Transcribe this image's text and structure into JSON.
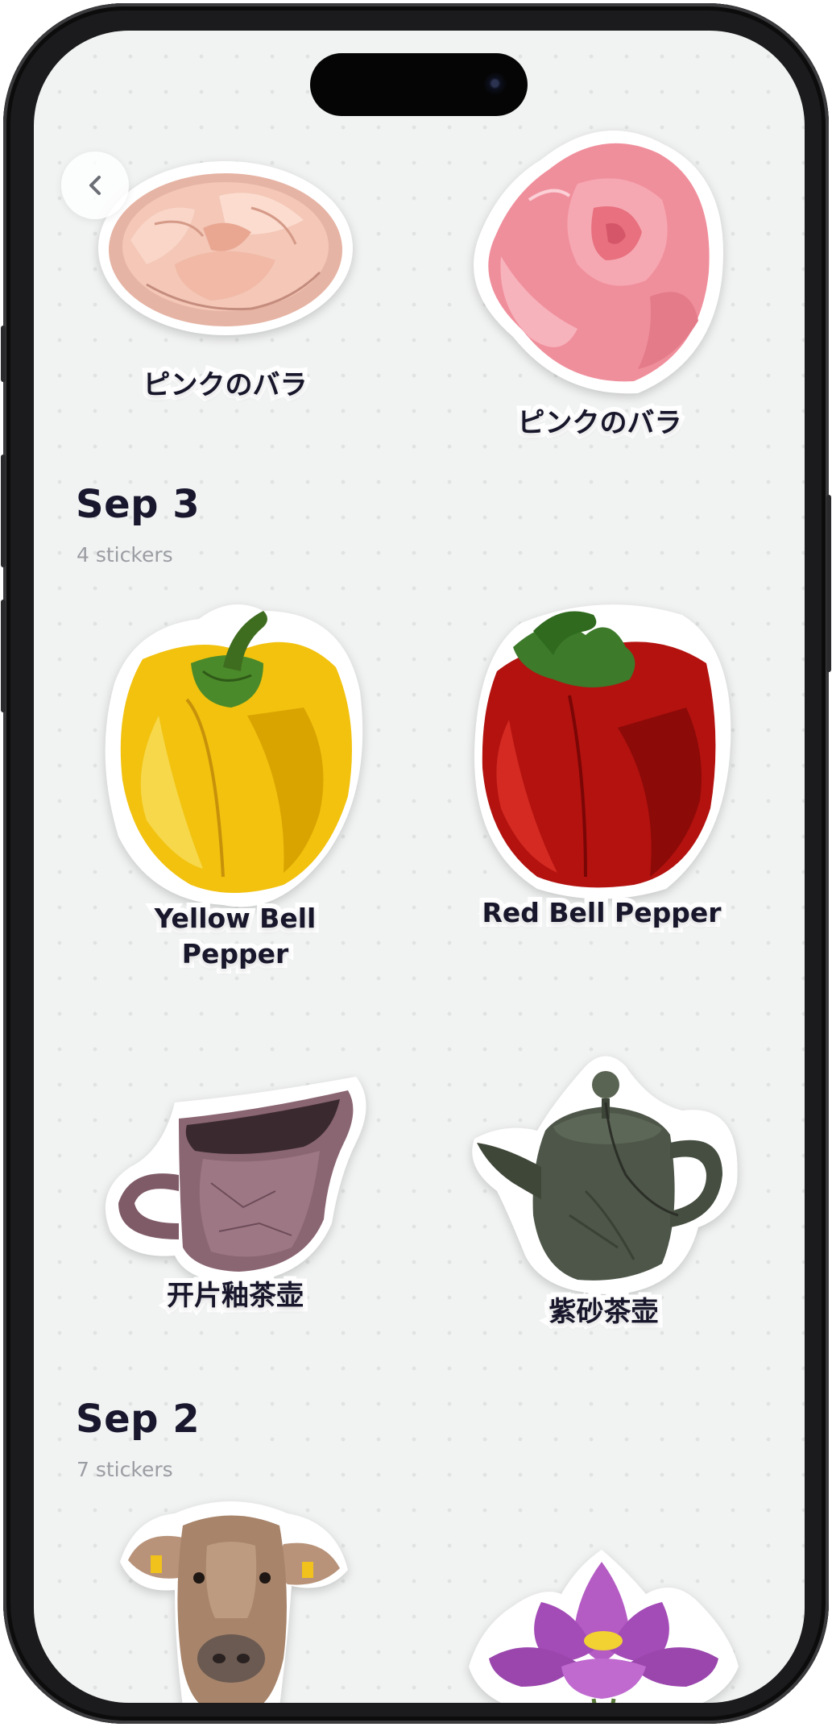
{
  "navigation": {
    "back_icon": "chevron-left-icon"
  },
  "sections": [
    {
      "title": "",
      "count": "",
      "stickers": [
        {
          "label": "ピンクのバラ",
          "icon": "pink-carnation-image"
        },
        {
          "label": "ピンクのバラ",
          "icon": "pink-rose-image"
        }
      ]
    },
    {
      "title": "Sep 3",
      "count": "4 stickers",
      "stickers": [
        {
          "label_line1": "Yellow Bell",
          "label_line2": "Pepper",
          "icon": "yellow-bell-pepper-image"
        },
        {
          "label": "Red Bell Pepper",
          "icon": "red-bell-pepper-image"
        },
        {
          "label": "开片釉茶壶",
          "icon": "purple-glaze-pitcher-image"
        },
        {
          "label": "紫砂茶壶",
          "icon": "clay-teapot-image"
        }
      ]
    },
    {
      "title": "Sep 2",
      "count": "7 stickers",
      "stickers": [
        {
          "label": "",
          "icon": "cow-image"
        },
        {
          "label": "",
          "icon": "purple-lotus-image"
        }
      ]
    }
  ],
  "colors": {
    "background": "#f1f2f2",
    "text": "#18172e",
    "muted": "#9a9da2",
    "sticker_border": "#ffffff"
  }
}
